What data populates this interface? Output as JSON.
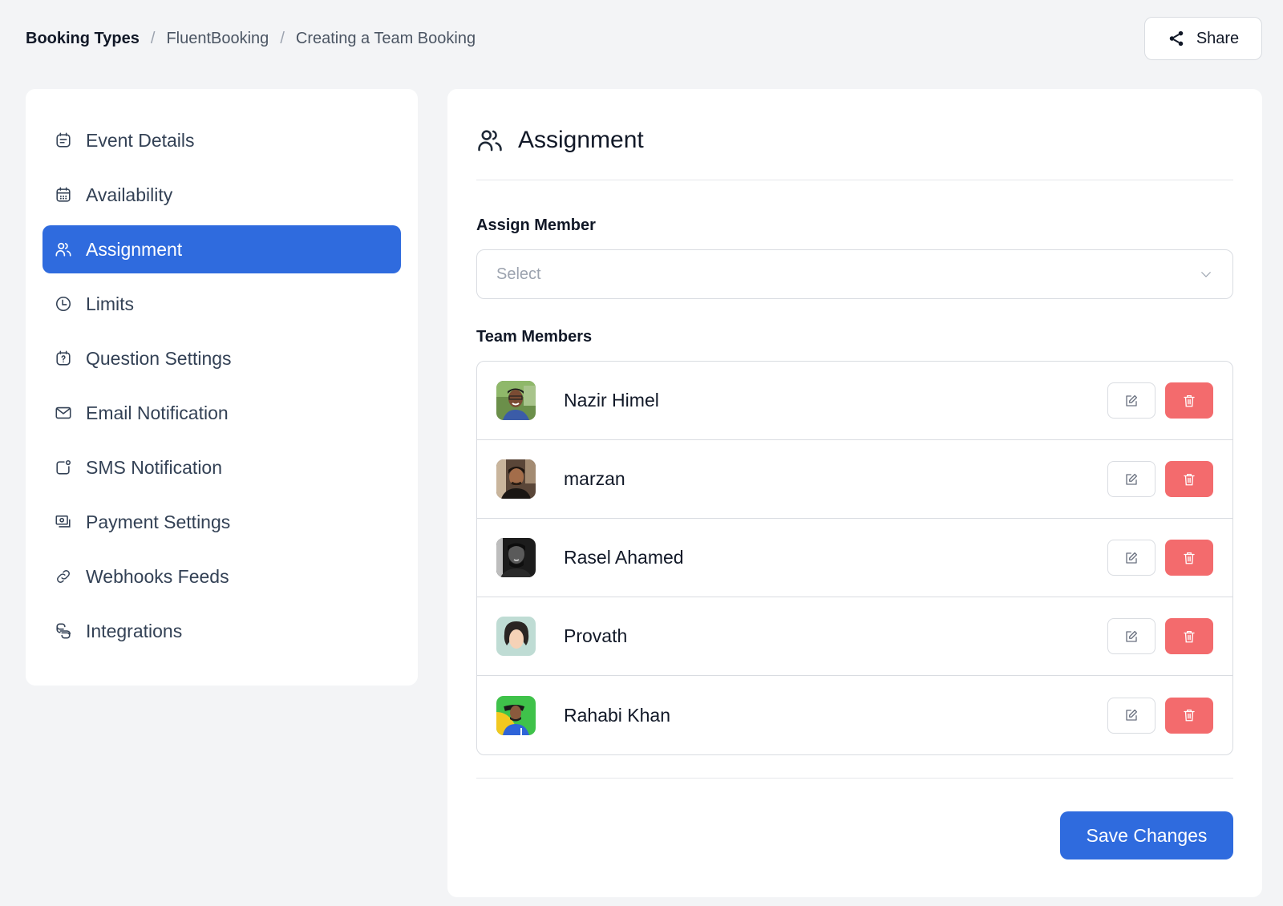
{
  "breadcrumb": {
    "items": [
      "Booking Types",
      "FluentBooking",
      "Creating a Team Booking"
    ],
    "separator": "/"
  },
  "header": {
    "share_label": "Share",
    "share_icon": "share-icon"
  },
  "sidebar": {
    "active_index": 2,
    "items": [
      {
        "label": "Event Details",
        "icon": "calendar-note-icon"
      },
      {
        "label": "Availability",
        "icon": "calendar-icon"
      },
      {
        "label": "Assignment",
        "icon": "users-icon"
      },
      {
        "label": "Limits",
        "icon": "clock-icon"
      },
      {
        "label": "Question Settings",
        "icon": "calendar-question-icon"
      },
      {
        "label": "Email Notification",
        "icon": "mail-icon"
      },
      {
        "label": "SMS Notification",
        "icon": "sms-notification-icon"
      },
      {
        "label": "Payment Settings",
        "icon": "payment-icon"
      },
      {
        "label": "Webhooks Feeds",
        "icon": "link-icon"
      },
      {
        "label": "Integrations",
        "icon": "integrations-icon"
      }
    ]
  },
  "main": {
    "title": "Assignment",
    "title_icon": "users-icon",
    "assign_member": {
      "label": "Assign Member",
      "placeholder": "Select"
    },
    "team_members": {
      "label": "Team Members",
      "members": [
        {
          "name": "Nazir Himel"
        },
        {
          "name": "marzan"
        },
        {
          "name": "Rasel Ahamed"
        },
        {
          "name": "Provath"
        },
        {
          "name": "Rahabi Khan"
        }
      ]
    },
    "save_label": "Save Changes"
  },
  "colors": {
    "accent": "#2f6bde",
    "danger": "#f36b6d",
    "background": "#f3f4f6"
  }
}
